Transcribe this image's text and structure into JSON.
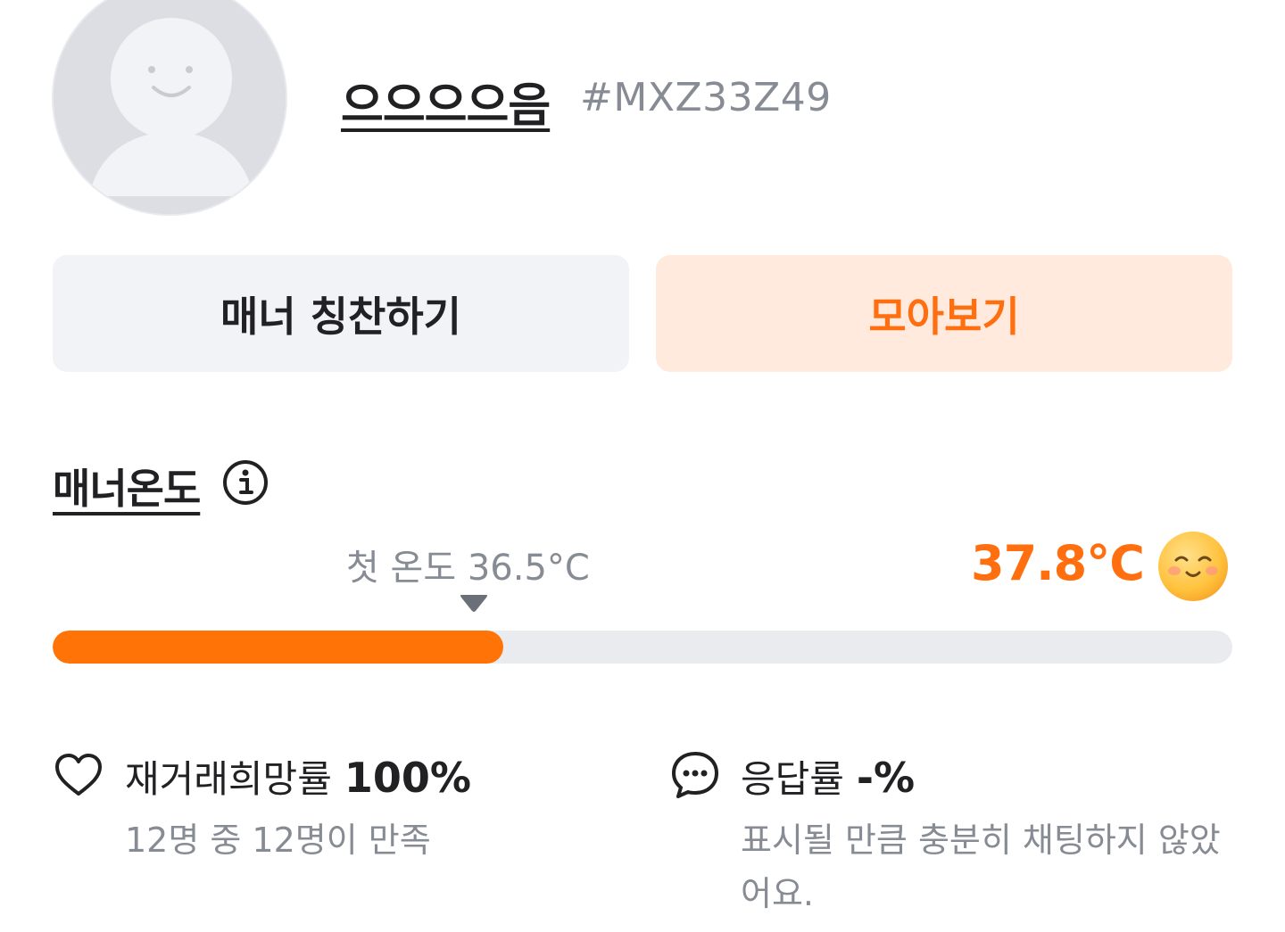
{
  "profile": {
    "nickname": "으으으으음",
    "user_id": "#MXZ33Z49",
    "avatar_icon": "default-avatar-icon"
  },
  "actions": {
    "praise_label": "매너 칭찬하기",
    "collect_label": "모아보기"
  },
  "manner": {
    "title": "매너온도",
    "info_icon": "info-icon",
    "first_temp_label": "첫 온도 36.5°C",
    "current_temp": "37.8°C",
    "temp_icon": "smiling-face-icon",
    "progress_fraction": 0.378,
    "accent_color": "#ff6f0f"
  },
  "stats": {
    "rebuy": {
      "icon": "heart-icon",
      "label": "재거래희망률",
      "value": "100%",
      "sub": "12명 중 12명이 만족"
    },
    "response": {
      "icon": "chat-bubble-icon",
      "label": "응답률",
      "value": "-%",
      "sub": "표시될 만큼 충분히 채팅하지 않았어요."
    }
  }
}
